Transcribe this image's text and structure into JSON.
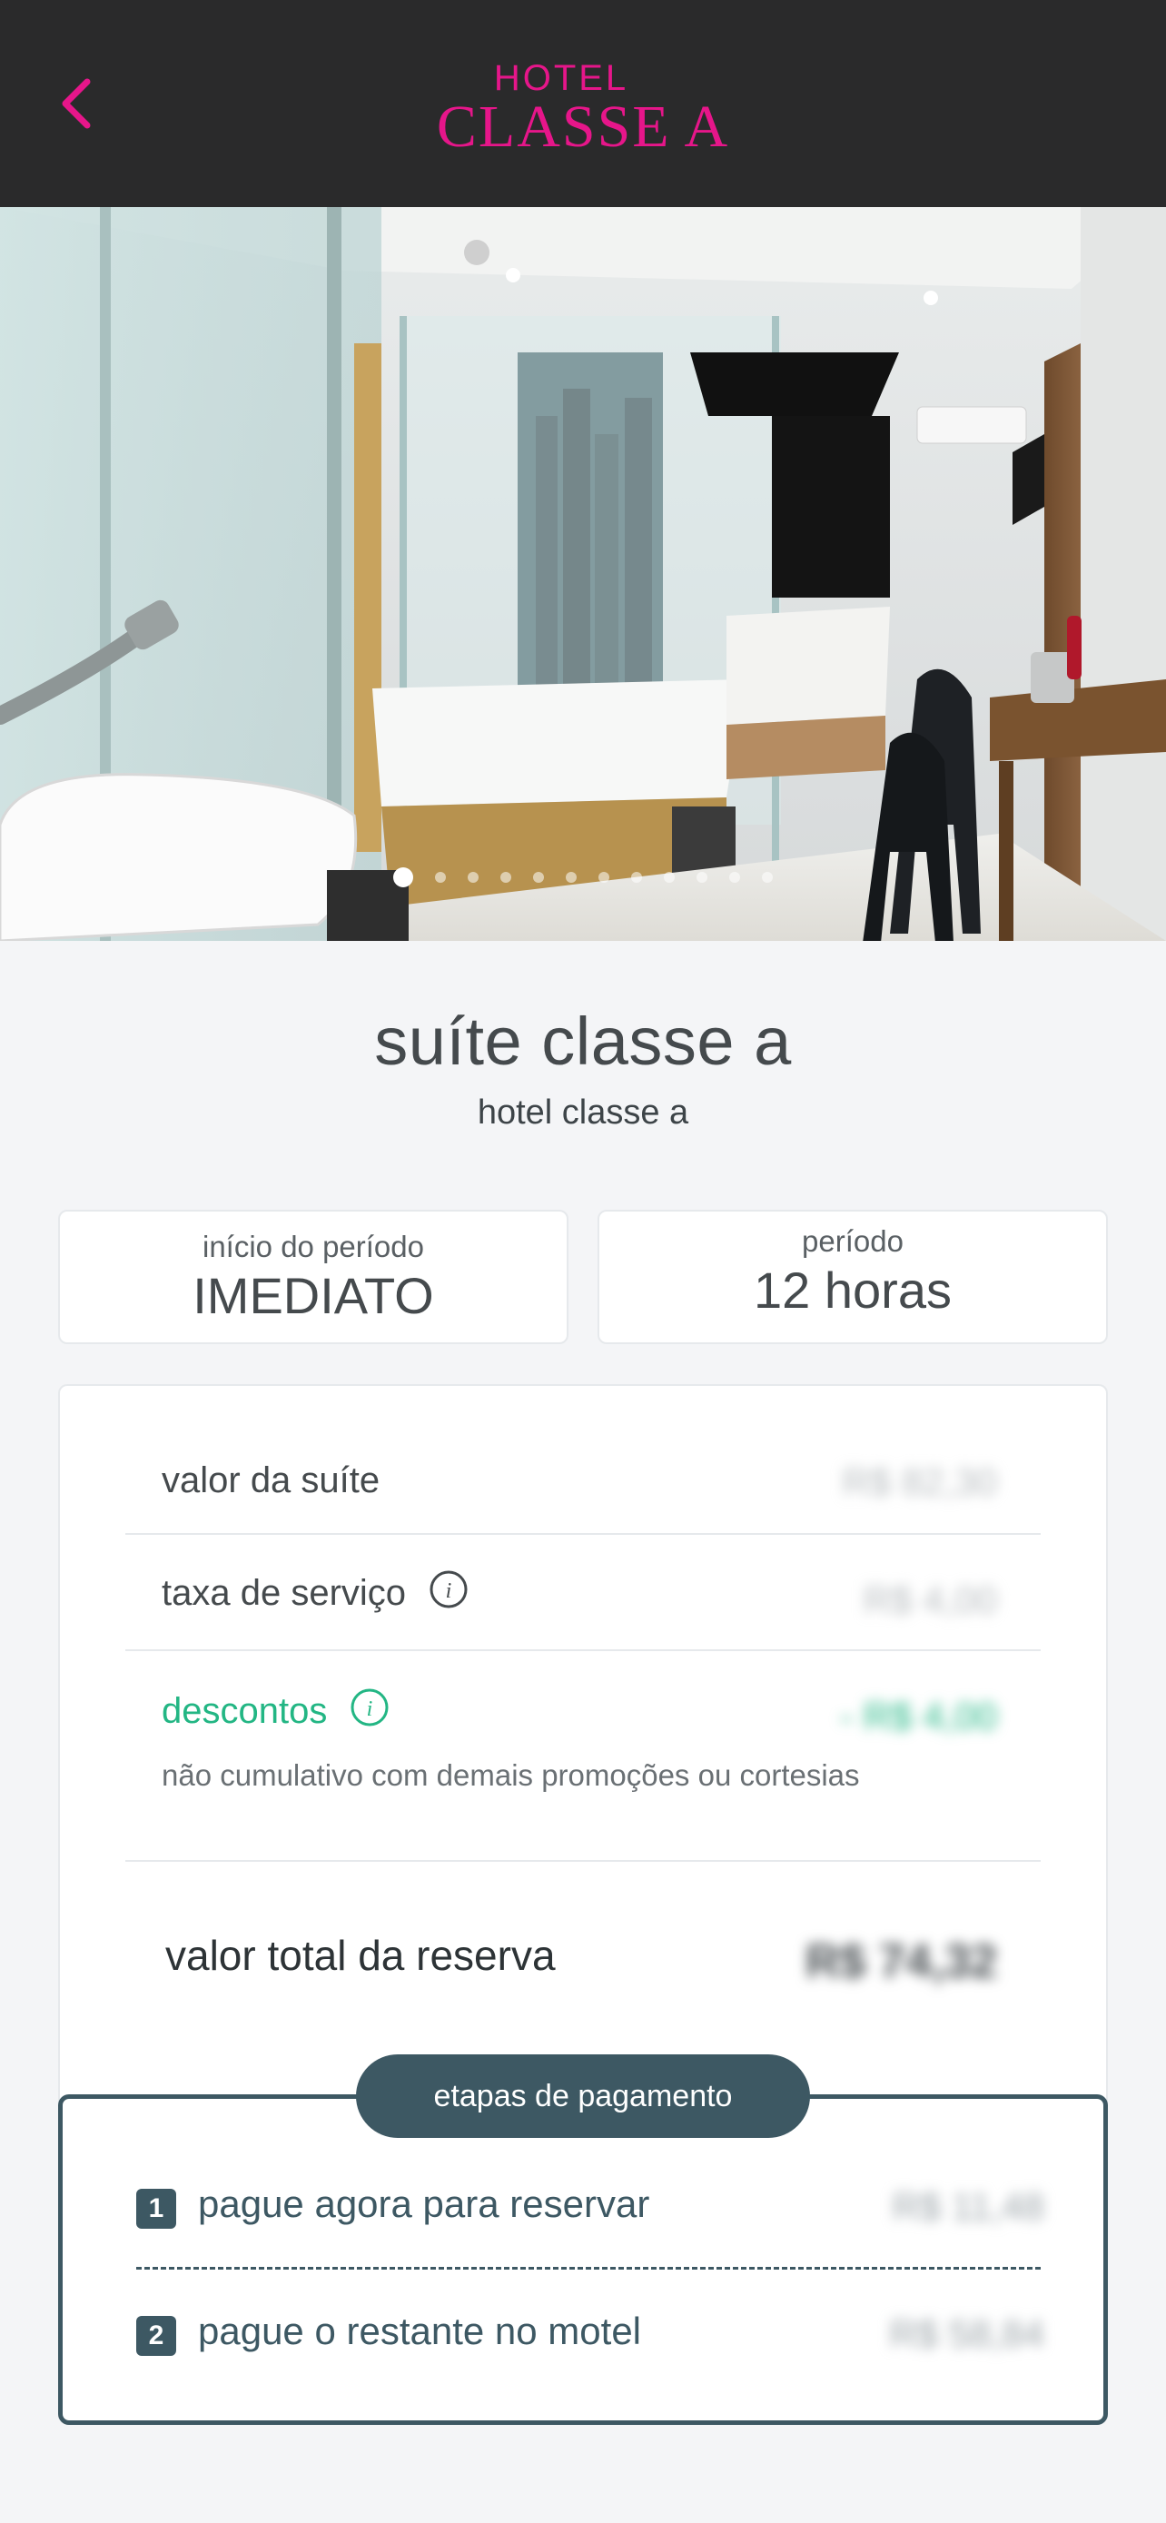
{
  "header": {
    "back_icon": "chevron-left-icon",
    "logo_top": "HOTEL",
    "logo_main": "CLASSE A",
    "accent_color": "#e6168a",
    "background_color": "#2a2a2b"
  },
  "gallery": {
    "image_description_icon": "photo",
    "slide_count": 12,
    "active_slide": 1
  },
  "suite": {
    "name": "suíte classe a",
    "hotel": "hotel classe a"
  },
  "period": {
    "start_label": "início do período",
    "start_value": "IMEDIATO",
    "duration_label": "período",
    "duration_value": "12 horas"
  },
  "pricing": {
    "suite_value_label": "valor da suíte",
    "suite_value": "R$ 82,30",
    "service_fee_label": "taxa de serviço",
    "service_fee": "R$ 4,00",
    "discount_label": "descontos",
    "discount_value": "- R$ 4,00",
    "discount_note": "não cumulativo com demais promoções ou cortesias",
    "total_label": "valor total da reserva",
    "total_value": "R$ 74,32",
    "discount_color": "#23b684"
  },
  "payment_steps": {
    "title": "etapas de pagamento",
    "step1_number": "1",
    "step1_label": "pague agora para reservar",
    "step1_value": "R$ 11,48",
    "step2_number": "2",
    "step2_label": "pague o restante no motel",
    "step2_value": "R$ 58,84",
    "color": "#3d5863"
  }
}
